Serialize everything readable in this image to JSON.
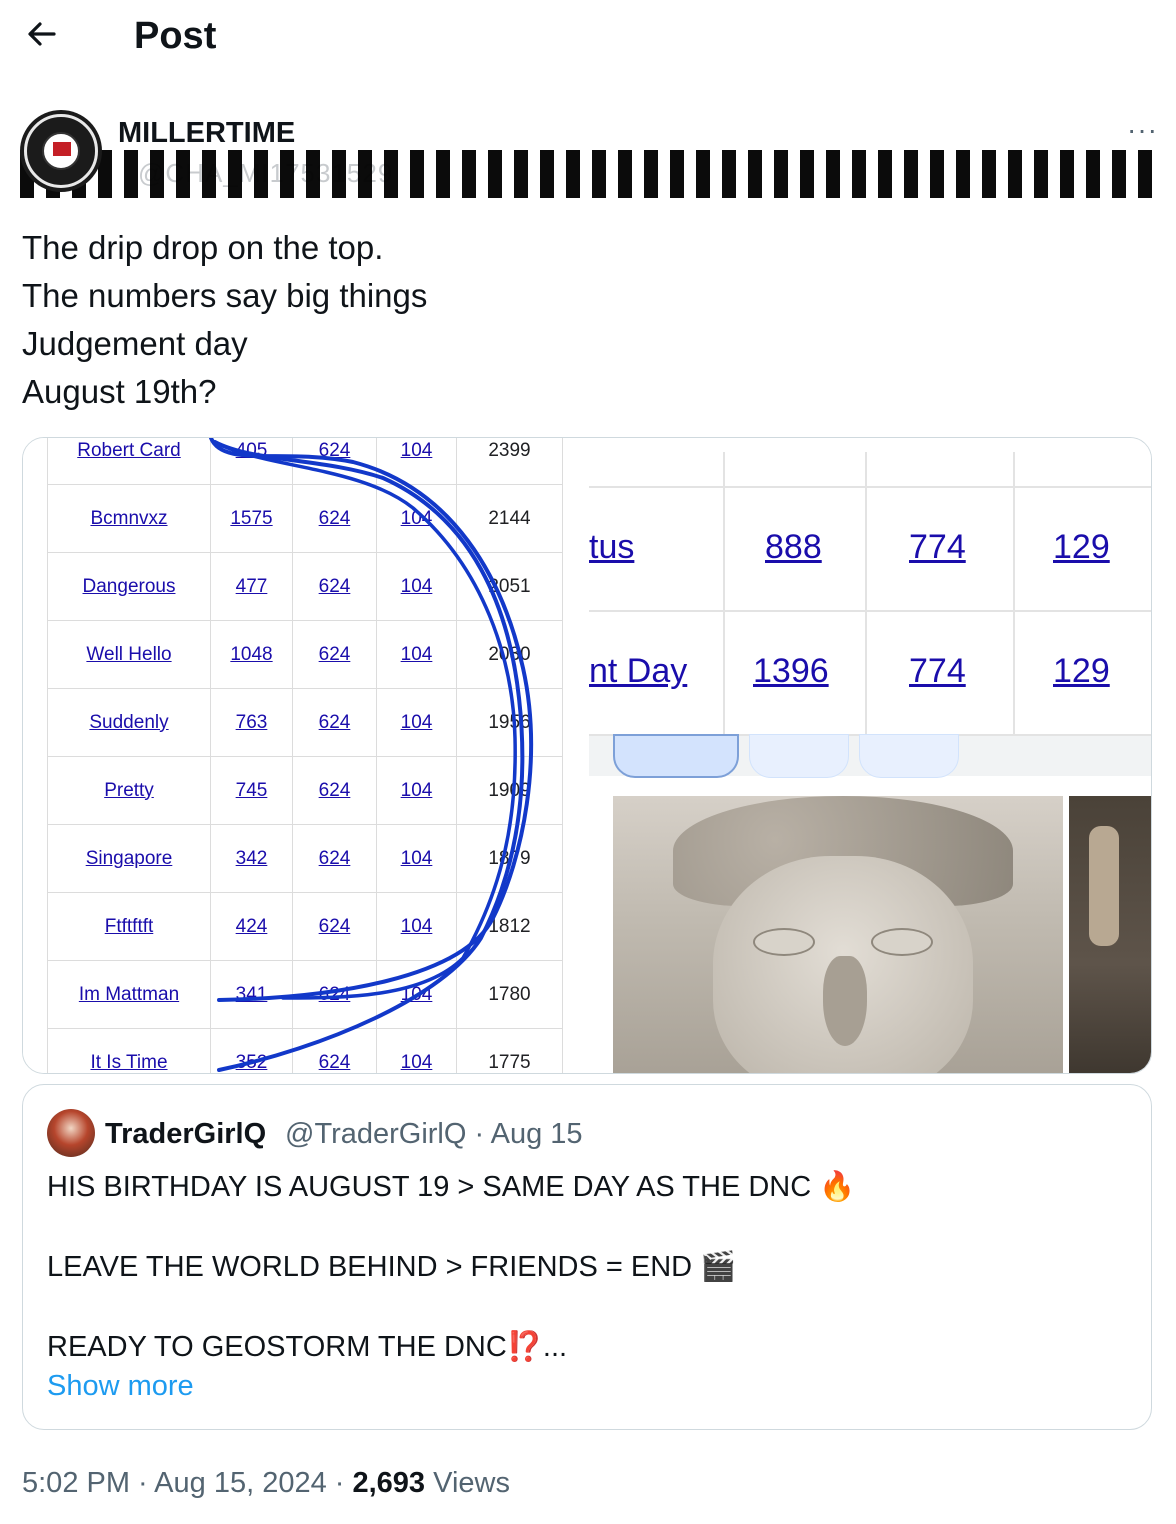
{
  "header": {
    "title": "Post",
    "back_icon": "arrow-left-icon"
  },
  "author": {
    "display_name": "MILLERTIME",
    "handle": "@CHA_MI17531529"
  },
  "post": {
    "lines": [
      "The drip drop on the top.",
      "The numbers say big things",
      "Judgement day",
      "August 19th?"
    ]
  },
  "media_left_table": [
    [
      "Robert Card",
      "405",
      "624",
      "104",
      "2399"
    ],
    [
      "Bcmnvxz",
      "1575",
      "624",
      "104",
      "2144"
    ],
    [
      "Dangerous",
      "477",
      "624",
      "104",
      "2051"
    ],
    [
      "Well Hello",
      "1048",
      "624",
      "104",
      "2030"
    ],
    [
      "Suddenly",
      "763",
      "624",
      "104",
      "1956"
    ],
    [
      "Pretty",
      "745",
      "624",
      "104",
      "1909"
    ],
    [
      "Singapore",
      "342",
      "624",
      "104",
      "1879"
    ],
    [
      "Ftftftft",
      "424",
      "624",
      "104",
      "1812"
    ],
    [
      "Im Mattman",
      "341",
      "624",
      "104",
      "1780"
    ],
    [
      "It Is Time",
      "352",
      "624",
      "104",
      "1775"
    ]
  ],
  "media_right_table": [
    [
      "tus",
      "888",
      "774",
      "129"
    ],
    [
      "nt Day",
      "1396",
      "774",
      "129"
    ]
  ],
  "quote": {
    "name": "TraderGirlQ",
    "meta": "@TraderGirlQ · Aug 15",
    "line1": "HIS BIRTHDAY IS AUGUST 19 > SAME DAY AS THE DNC 🔥",
    "line2": "LEAVE THE WORLD BEHIND > FRIENDS = END 🎬",
    "line3": "READY TO GEOSTORM THE DNC⁉️...",
    "show_more": "Show more"
  },
  "footer": {
    "time": "5:02 PM · Aug 15, 2024 · ",
    "views": "2,693",
    "views_label": " Views"
  },
  "colors": {
    "link": "#1a0dab",
    "accent": "#1d9bf0",
    "muted": "#536471",
    "scribble": "#1238c9"
  }
}
